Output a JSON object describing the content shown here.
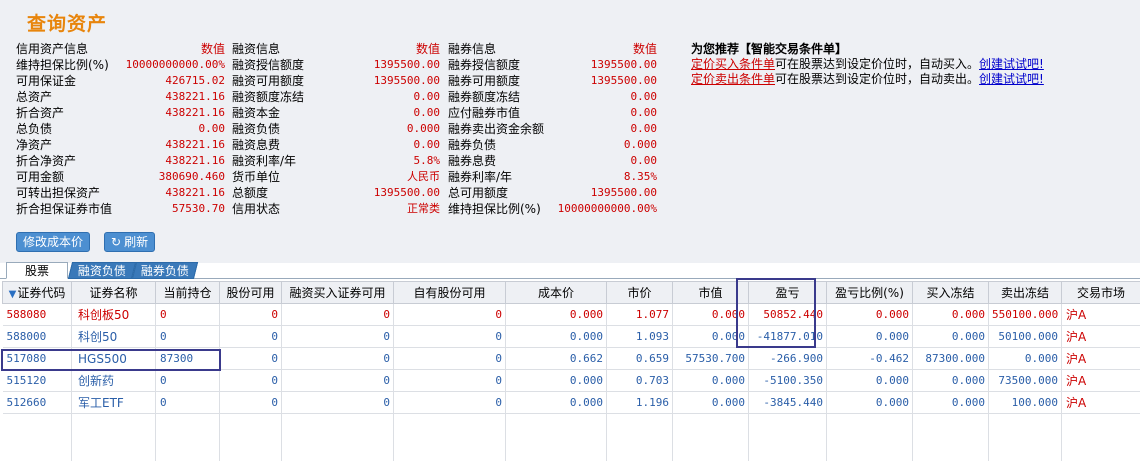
{
  "page_title": "查询资产",
  "credit": {
    "header": {
      "label": "信用资产信息",
      "value": "数值"
    },
    "rows": [
      {
        "label": "维持担保比例(%)",
        "value": "10000000000.00%"
      },
      {
        "label": "可用保证金",
        "value": "426715.02"
      },
      {
        "label": "总资产",
        "value": "438221.16"
      },
      {
        "label": "折合资产",
        "value": "438221.16"
      },
      {
        "label": "总负债",
        "value": "0.00"
      },
      {
        "label": "净资产",
        "value": "438221.16"
      },
      {
        "label": "折合净资产",
        "value": "438221.16"
      },
      {
        "label": "可用金额",
        "value": "380690.460"
      },
      {
        "label": "可转出担保资产",
        "value": "438221.16"
      },
      {
        "label": "折合担保证券市值",
        "value": "57530.70"
      }
    ]
  },
  "financing": {
    "header": {
      "label": "融资信息",
      "value": "数值"
    },
    "rows": [
      {
        "label": "融资授信额度",
        "value": "1395500.00"
      },
      {
        "label": "融资可用额度",
        "value": "1395500.00"
      },
      {
        "label": "融资额度冻结",
        "value": "0.00"
      },
      {
        "label": "融资本金",
        "value": "0.00"
      },
      {
        "label": "融资负债",
        "value": "0.000"
      },
      {
        "label": "融资息费",
        "value": "0.00"
      },
      {
        "label": "融资利率/年",
        "value": "5.8%"
      },
      {
        "label": "货币单位",
        "value": "人民币"
      },
      {
        "label": "总额度",
        "value": "1395500.00"
      },
      {
        "label": "信用状态",
        "value": "正常类"
      }
    ]
  },
  "securities_lending": {
    "header": {
      "label": "融券信息",
      "value": "数值"
    },
    "rows": [
      {
        "label": "融券授信额度",
        "value": "1395500.00"
      },
      {
        "label": "融券可用额度",
        "value": "1395500.00"
      },
      {
        "label": "融券额度冻结",
        "value": "0.00"
      },
      {
        "label": "应付融券市值",
        "value": "0.00"
      },
      {
        "label": "融券卖出资金余额",
        "value": "0.00"
      },
      {
        "label": "融券负债",
        "value": "0.000"
      },
      {
        "label": "融券息费",
        "value": "0.00"
      },
      {
        "label": "融券利率/年",
        "value": "8.35%"
      },
      {
        "label": "总可用额度",
        "value": "1395500.00"
      },
      {
        "label": "维持担保比例(%)",
        "value": "10000000000.00%"
      }
    ]
  },
  "recommend": {
    "title": "为您推荐【智能交易条件单】",
    "lines": [
      {
        "link": "定价买入条件单",
        "text": "可在股票达到设定价位时，自动买入。",
        "action": "创建试试吧!"
      },
      {
        "link": "定价卖出条件单",
        "text": "可在股票达到设定价位时，自动卖出。",
        "action": "创建试试吧!"
      }
    ]
  },
  "buttons": {
    "edit_cost": "修改成本价",
    "refresh": "刷新"
  },
  "tabs": [
    "股票",
    "融资负债",
    "融券负债"
  ],
  "table": {
    "columns": [
      "证券代码",
      "证券名称",
      "当前持仓",
      "股份可用",
      "融资买入证券可用",
      "自有股份可用",
      "成本价",
      "市价",
      "市值",
      "盈亏",
      "盈亏比例(%)",
      "买入冻结",
      "卖出冻结",
      "交易市场"
    ],
    "rows": [
      {
        "dir": "up",
        "cells": [
          "588080",
          "科创板50",
          "0",
          "0",
          "0",
          "0",
          "0.000",
          "1.077",
          "0.000",
          "50852.440",
          "0.000",
          "0.000",
          "550100.000",
          "沪A"
        ]
      },
      {
        "dir": "dn",
        "cells": [
          "588000",
          "科创50",
          "0",
          "0",
          "0",
          "0",
          "0.000",
          "1.093",
          "0.000",
          "-41877.010",
          "0.000",
          "0.000",
          "50100.000",
          "沪A"
        ]
      },
      {
        "dir": "dn",
        "cells": [
          "517080",
          "HGS500",
          "87300",
          "0",
          "0",
          "0",
          "0.662",
          "0.659",
          "57530.700",
          "-266.900",
          "-0.462",
          "87300.000",
          "0.000",
          "沪A"
        ]
      },
      {
        "dir": "dn",
        "cells": [
          "515120",
          "创新药",
          "0",
          "0",
          "0",
          "0",
          "0.000",
          "0.703",
          "0.000",
          "-5100.350",
          "0.000",
          "0.000",
          "73500.000",
          "沪A"
        ]
      },
      {
        "dir": "dn",
        "cells": [
          "512660",
          "军工ETF",
          "0",
          "0",
          "0",
          "0",
          "0.000",
          "1.196",
          "0.000",
          "-3845.440",
          "0.000",
          "0.000",
          "100.000",
          "沪A"
        ]
      }
    ]
  },
  "colors": {
    "title": "#e8850c",
    "positive": "#cc0000",
    "negative": "#2a5ea8",
    "tab_inactive": "#3a79b9",
    "highlight_box": "#3a3a8c"
  }
}
